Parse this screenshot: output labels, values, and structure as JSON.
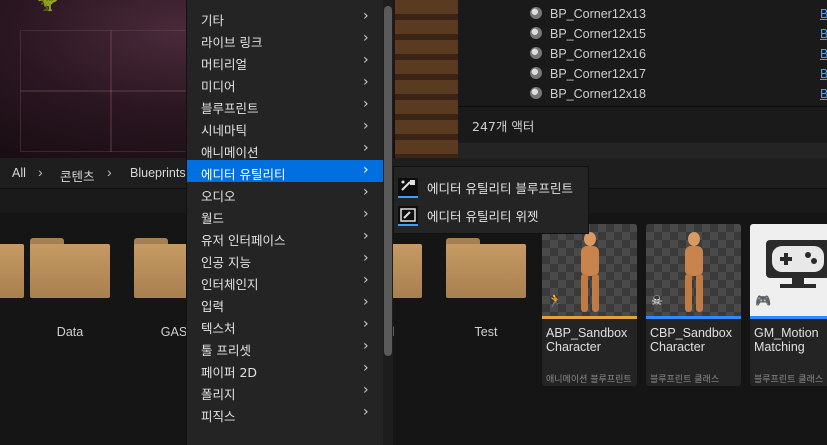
{
  "outliner": {
    "rows": [
      {
        "label": "BP_Corner12x13",
        "type": "B"
      },
      {
        "label": "BP_Corner12x15",
        "type": "B"
      },
      {
        "label": "BP_Corner12x16",
        "type": "B"
      },
      {
        "label": "BP_Corner12x17",
        "type": "B"
      },
      {
        "label": "BP_Corner12x18",
        "type": "B"
      }
    ],
    "actor_count": "247개 액터"
  },
  "pathbar": {
    "items": [
      "All",
      "콘텐츠",
      "Blueprints"
    ]
  },
  "folders": [
    {
      "label": "Data"
    },
    {
      "label": "GAS"
    },
    {
      "label": "eted\nters"
    },
    {
      "label": "Test"
    }
  ],
  "assets": [
    {
      "name": "ABP_Sandbox Character",
      "type": "애니메이션 블루프린트",
      "strip_color": "#e2a23a",
      "icon": "running-man-icon"
    },
    {
      "name": "CBP_Sandbox Character",
      "type": "블루프린트 클래스",
      "strip_color": "#2e8bff",
      "icon": "skull-icon"
    },
    {
      "name": "GM_Motion Matching",
      "type": "블루프린트 클래스",
      "strip_color": "#2e8bff",
      "icon": "gamepad-icon"
    }
  ],
  "menu": {
    "items": [
      {
        "label": "기타",
        "selected": false
      },
      {
        "label": "라이브 링크",
        "selected": false
      },
      {
        "label": "머티리얼",
        "selected": false
      },
      {
        "label": "미디어",
        "selected": false
      },
      {
        "label": "블루프린트",
        "selected": false
      },
      {
        "label": "시네마틱",
        "selected": false
      },
      {
        "label": "애니메이션",
        "selected": false
      },
      {
        "label": "에디터 유틸리티",
        "selected": true
      },
      {
        "label": "오디오",
        "selected": false
      },
      {
        "label": "월드",
        "selected": false
      },
      {
        "label": "유저 인터페이스",
        "selected": false
      },
      {
        "label": "인공 지능",
        "selected": false
      },
      {
        "label": "인터체인지",
        "selected": false
      },
      {
        "label": "입력",
        "selected": false
      },
      {
        "label": "텍스처",
        "selected": false
      },
      {
        "label": "툴 프리셋",
        "selected": false
      },
      {
        "label": "페이퍼 2D",
        "selected": false
      },
      {
        "label": "폴리지",
        "selected": false
      },
      {
        "label": "피직스",
        "selected": false
      }
    ]
  },
  "submenu": {
    "items": [
      {
        "label": "에디터 유틸리티 블루프린트"
      },
      {
        "label": "에디터 유틸리티 위젯"
      }
    ]
  },
  "colors": {
    "selection": "#0070e0",
    "link": "#4aa3ff",
    "folder": "#c59a63"
  }
}
